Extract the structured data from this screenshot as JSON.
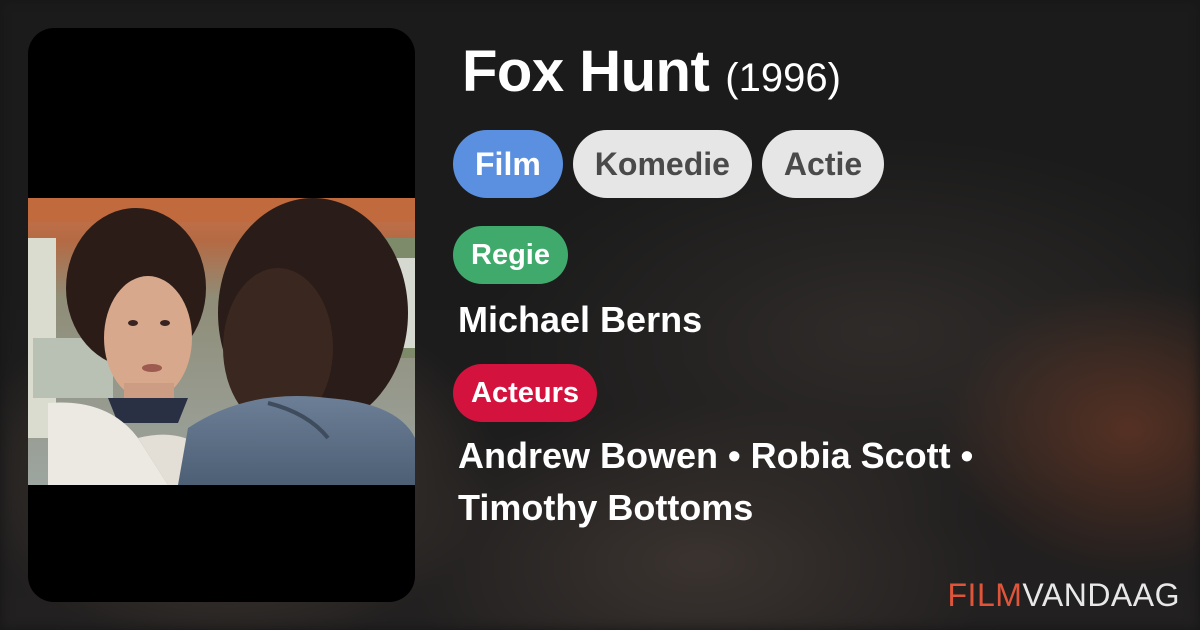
{
  "movie": {
    "title": "Fox Hunt",
    "year": "(1996)"
  },
  "genres": [
    {
      "label": "Film",
      "active": true
    },
    {
      "label": "Komedie",
      "active": false
    },
    {
      "label": "Actie",
      "active": false
    }
  ],
  "regie": {
    "label": "Regie",
    "names": "Michael Berns"
  },
  "acteurs": {
    "label": "Acteurs",
    "line1": "Andrew Bowen • Robia Scott •",
    "line2": "Timothy Bottoms"
  },
  "brand": {
    "part1": "FILM",
    "part2": "VANDAAG"
  },
  "colors": {
    "film_chip": "#5b8fe0",
    "genre_chip": "#e6e6e6",
    "regie_badge": "#3faa6b",
    "acteurs_badge": "#d4123e",
    "brand_accent": "#e0553a"
  }
}
